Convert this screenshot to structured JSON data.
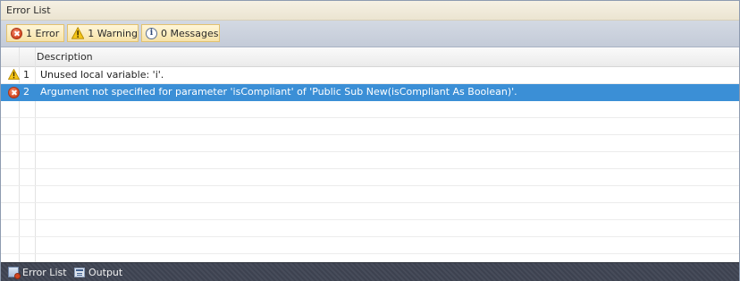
{
  "panel": {
    "title": "Error List"
  },
  "filters": {
    "errors": {
      "label": "1 Error",
      "icon": "error-icon"
    },
    "warnings": {
      "label": "1 Warning",
      "icon": "warning-icon"
    },
    "messages": {
      "label": "0 Messages",
      "icon": "info-icon"
    }
  },
  "table": {
    "columns": {
      "description": "Description"
    },
    "rows": [
      {
        "number": "1",
        "type": "warning",
        "description": "Unused local variable: 'i'."
      },
      {
        "number": "2",
        "type": "error",
        "description": "Argument not specified for parameter 'isCompliant' of 'Public Sub New(isCompliant As Boolean)'."
      }
    ],
    "selected_row": "2"
  },
  "bottom_tabs": [
    {
      "label": "Error List",
      "icon": "error-list-icon"
    },
    {
      "label": "Output",
      "icon": "output-icon"
    }
  ],
  "colors": {
    "selection": "#3b8fd6",
    "filter_button": "#f7e3a8",
    "toolbar": "#c4cbd8",
    "bottom_bar": "#404552"
  }
}
